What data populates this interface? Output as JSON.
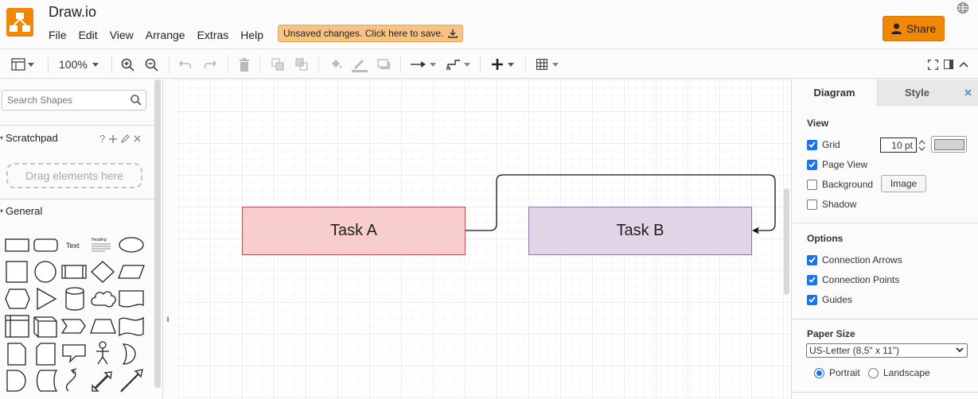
{
  "app": {
    "title": "Draw.io"
  },
  "menu": [
    "File",
    "Edit",
    "View",
    "Arrange",
    "Extras",
    "Help"
  ],
  "unsaved_notice": "Unsaved changes. Click here to save.",
  "share_label": "Share",
  "toolbar": {
    "zoom": "100%"
  },
  "sidebar": {
    "search_placeholder": "Search Shapes",
    "scratchpad": {
      "title": "Scratchpad",
      "help": "?",
      "drop_hint": "Drag elements here"
    },
    "general_title": "General",
    "shape_text_label": "Text",
    "shape_heading_label": "Heading"
  },
  "diagram": {
    "nodes": [
      {
        "label": "Task A",
        "fill": "#f8cecc",
        "stroke": "#b85450"
      },
      {
        "label": "Task B",
        "fill": "#e1d5e7",
        "stroke": "#9673a6"
      }
    ]
  },
  "format_panel": {
    "tabs": [
      "Diagram",
      "Style"
    ],
    "view": {
      "title": "View",
      "grid": {
        "label": "Grid",
        "checked": true,
        "size": "10 pt",
        "color": "#d3d3d3"
      },
      "page_view": {
        "label": "Page View",
        "checked": true
      },
      "background": {
        "label": "Background",
        "checked": false,
        "button": "Image"
      },
      "shadow": {
        "label": "Shadow",
        "checked": false
      }
    },
    "options": {
      "title": "Options",
      "connection_arrows": {
        "label": "Connection Arrows",
        "checked": true
      },
      "connection_points": {
        "label": "Connection Points",
        "checked": true
      },
      "guides": {
        "label": "Guides",
        "checked": true
      }
    },
    "paper": {
      "title": "Paper Size",
      "selected": "US-Letter (8,5\" x 11\")",
      "orientation": [
        {
          "label": "Portrait",
          "selected": true
        },
        {
          "label": "Landscape",
          "selected": false
        }
      ]
    }
  },
  "colors": {
    "accent": "#f08705",
    "checkbox": "#1a73e8",
    "unsaved_bg": "#f8c382"
  }
}
